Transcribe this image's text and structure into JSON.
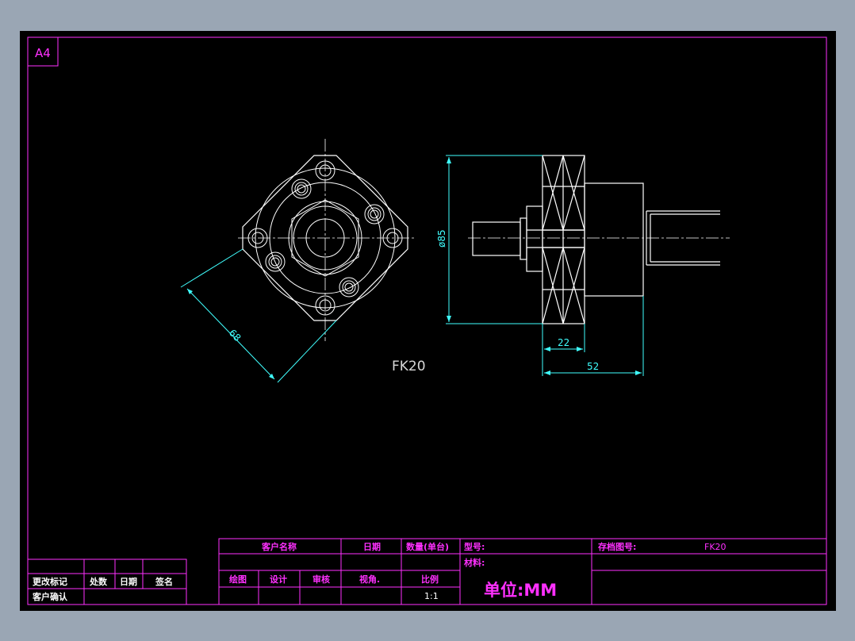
{
  "sheet": {
    "size_label": "A4"
  },
  "part": {
    "label": "FK20"
  },
  "dimensions": {
    "diag": "68",
    "dia": "ø85",
    "d22": "22",
    "d52": "52"
  },
  "title_block": {
    "customer_name": "客户名称",
    "date": "日期",
    "qty": "数量(单台)",
    "model": "型号:",
    "archive_no": "存档图号:",
    "archive_value": "FK20",
    "material": "材料:",
    "draw": "绘图",
    "design": "设计",
    "review": "审核",
    "view": "视角.",
    "scale_label": "比例",
    "scale_value": "1:1",
    "unit": "单位:MM",
    "change_mark": "更改标记",
    "count": "处数",
    "rev_date": "日期",
    "sign": "签名",
    "customer_confirm": "客户确认"
  },
  "colors": {
    "frame": "#ff30ff",
    "geometry": "#ffffff",
    "dimension": "#40ffff",
    "background": "#000000"
  }
}
